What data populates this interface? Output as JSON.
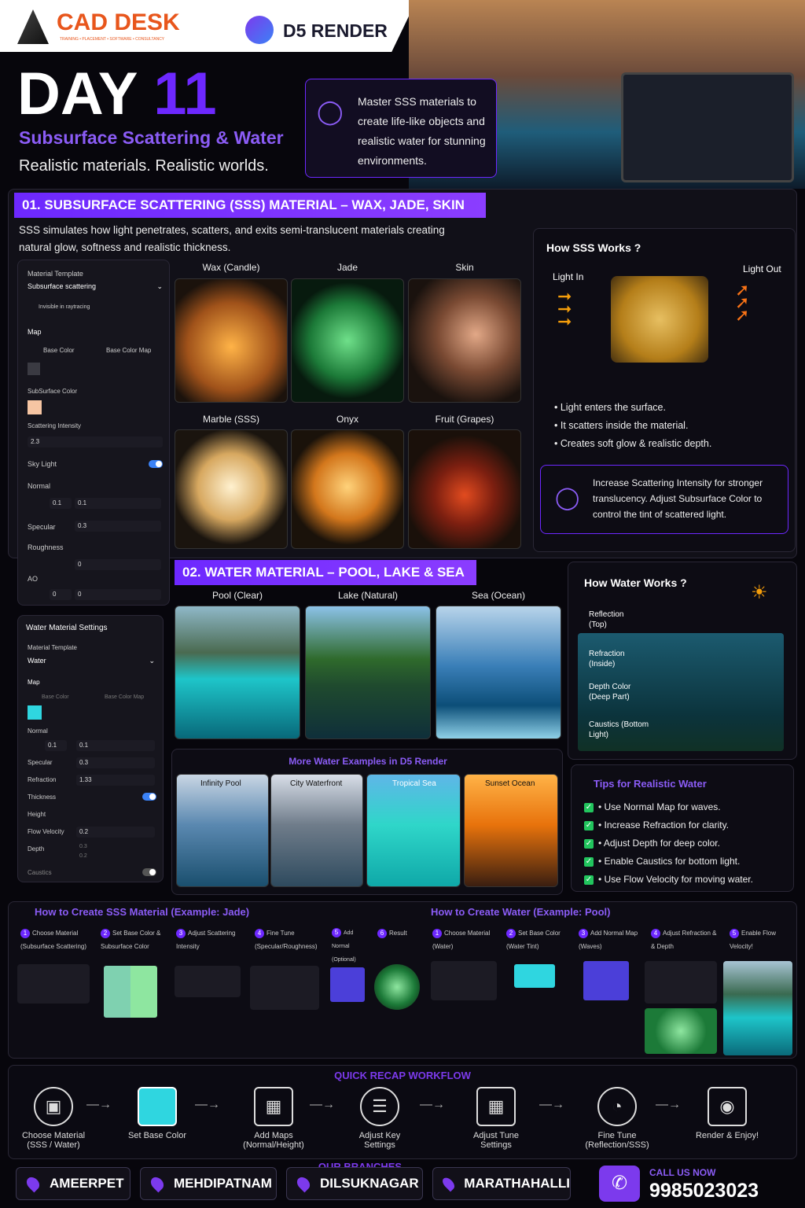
{
  "brand": {
    "logo_name": "CAD DESK",
    "logo_tag": "TRAINING • PLACEMENT • SOFTWARE • CONSULTANCY",
    "product": "D5 RENDER"
  },
  "hero": {
    "day": "DAY",
    "num": "11",
    "subtitle": "Subsurface Scattering & Water",
    "tagline": "Realistic materials. Realistic worlds.",
    "callout": "Master SSS materials to create life-like objects and realistic water for stunning environments."
  },
  "sss": {
    "heading": "01. SUBSURFACE SCATTERING (SSS) MATERIAL – WAX, JADE, SKIN",
    "desc": "SSS simulates how light penetrates, scatters, and exits semi-translucent materials creating natural glow, softness and realistic thickness.",
    "samples": [
      "Wax (Candle)",
      "Jade",
      "Skin",
      "Marble (SSS)",
      "Onyx",
      "Fruit (Grapes)"
    ],
    "panel": {
      "template_label": "Material Template",
      "template_value": "Subsurface scattering",
      "invisible": "Invisible in raytracing",
      "map": "Map",
      "base_color": "Base Color",
      "base_color_map": "Base Color Map",
      "sub_color": "SubSurface Color",
      "scatter_label": "Scattering Intensity",
      "scatter_value": "2.3",
      "sky_light": "Sky Light",
      "normal": "Normal",
      "normal_a": "0.1",
      "normal_b": "0.1",
      "specular": "Specular",
      "specular_value": "0.3",
      "roughness": "Roughness",
      "roughness_value": "0",
      "ao": "AO",
      "ao_a": "0",
      "ao_b": "0"
    },
    "how": {
      "title": "How SSS Works ?",
      "light_in": "Light In",
      "light_out": "Light Out",
      "bullets": [
        "Light enters the surface.",
        "It scatters inside the material.",
        "Creates soft glow & realistic depth."
      ],
      "tip": "Increase Scattering Intensity for stronger translucency. Adjust Subsurface Color to control the tint of scattered light."
    }
  },
  "water": {
    "heading": "02. WATER MATERIAL – POOL, LAKE & SEA",
    "samples": [
      "Pool (Clear)",
      "Lake (Natural)",
      "Sea (Ocean)"
    ],
    "panel": {
      "title": "Water Material Settings",
      "template_label": "Material Template",
      "template_value": "Water",
      "map": "Map",
      "base_color": "Base Color",
      "base_color_map": "Base Color Map",
      "normal": "Normal",
      "normal_a": "0.1",
      "normal_b": "0.1",
      "specular": "Specular",
      "specular_value": "0.3",
      "refraction": "Refraction",
      "refraction_value": "1.33",
      "thickness": "Thickness",
      "height": "Height",
      "flow": "Flow Velocity",
      "flow_value": "0.2",
      "depth": "Depth",
      "depth_a": "0.3",
      "depth_b": "0.2",
      "caustics": "Caustics"
    },
    "how": {
      "title": "How Water Works ?",
      "labels": [
        "Reflection (Top)",
        "Refraction (Inside)",
        "Depth Color (Deep Part)",
        "Caustics (Bottom Light)"
      ]
    },
    "more_title": "More Water Examples in D5 Render",
    "more": [
      "Infinity Pool",
      "City Waterfront",
      "Tropical Sea",
      "Sunset Ocean"
    ],
    "tips_title": "Tips for Realistic Water",
    "tips": [
      "Use Normal Map for waves.",
      "Increase Refraction for clarity.",
      "Adjust Depth for deep color.",
      "Enable Caustics for bottom light.",
      "Use Flow Velocity for moving water."
    ]
  },
  "steps_sss": {
    "title": "How to Create SSS Material (Example: Jade)",
    "steps": [
      "Choose Material (Subsurface Scattering)",
      "Set Base Color & Subsurface Color",
      "Adjust Scattering Intensity",
      "Fine Tune (Specular/Roughness)",
      "Add Normal (Optional)",
      "Result"
    ]
  },
  "steps_water": {
    "title": "How to Create Water (Example: Pool)",
    "steps": [
      "Choose Material (Water)",
      "Set Base Color (Water Tint)",
      "Add Normal Map (Waves)",
      "Adjust Refraction & & Depth",
      "Enable Flow Velocity!"
    ]
  },
  "recap": {
    "title": "QUICK RECAP WORKFLOW",
    "items": [
      "Choose Material (SSS / Water)",
      "Set Base Color",
      "Add Maps (Normal/Height)",
      "Adjust Key Settings",
      "Adjust Tune Settings",
      "Fine Tune (Reflection/SSS)",
      "Render & Enjoy!"
    ]
  },
  "footer": {
    "branches_title": "OUR BRANCHES",
    "branches": [
      "AMEERPET",
      "MEHDIPATNAM",
      "DILSUKNAGAR",
      "MARATHAHALLI"
    ],
    "call": "CALL US NOW",
    "phone": "9985023023"
  },
  "colors": {
    "accent": "#7c3aed",
    "purple_text": "#8b5cf6",
    "bg": "#07060c"
  }
}
